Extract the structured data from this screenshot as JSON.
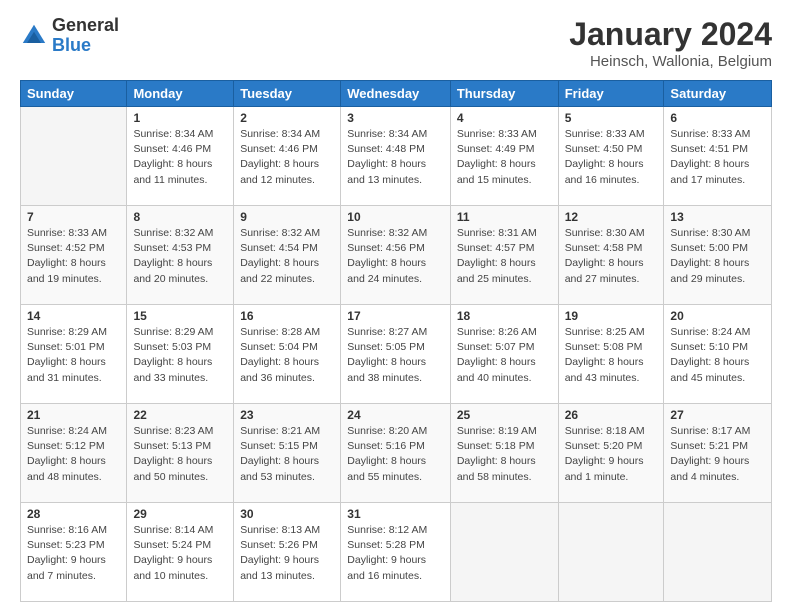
{
  "logo": {
    "general": "General",
    "blue": "Blue"
  },
  "header": {
    "month_year": "January 2024",
    "location": "Heinsch, Wallonia, Belgium"
  },
  "weekdays": [
    "Sunday",
    "Monday",
    "Tuesday",
    "Wednesday",
    "Thursday",
    "Friday",
    "Saturday"
  ],
  "weeks": [
    [
      {
        "day": "",
        "info": ""
      },
      {
        "day": "1",
        "info": "Sunrise: 8:34 AM\nSunset: 4:46 PM\nDaylight: 8 hours\nand 11 minutes."
      },
      {
        "day": "2",
        "info": "Sunrise: 8:34 AM\nSunset: 4:46 PM\nDaylight: 8 hours\nand 12 minutes."
      },
      {
        "day": "3",
        "info": "Sunrise: 8:34 AM\nSunset: 4:48 PM\nDaylight: 8 hours\nand 13 minutes."
      },
      {
        "day": "4",
        "info": "Sunrise: 8:33 AM\nSunset: 4:49 PM\nDaylight: 8 hours\nand 15 minutes."
      },
      {
        "day": "5",
        "info": "Sunrise: 8:33 AM\nSunset: 4:50 PM\nDaylight: 8 hours\nand 16 minutes."
      },
      {
        "day": "6",
        "info": "Sunrise: 8:33 AM\nSunset: 4:51 PM\nDaylight: 8 hours\nand 17 minutes."
      }
    ],
    [
      {
        "day": "7",
        "info": "Sunrise: 8:33 AM\nSunset: 4:52 PM\nDaylight: 8 hours\nand 19 minutes."
      },
      {
        "day": "8",
        "info": "Sunrise: 8:32 AM\nSunset: 4:53 PM\nDaylight: 8 hours\nand 20 minutes."
      },
      {
        "day": "9",
        "info": "Sunrise: 8:32 AM\nSunset: 4:54 PM\nDaylight: 8 hours\nand 22 minutes."
      },
      {
        "day": "10",
        "info": "Sunrise: 8:32 AM\nSunset: 4:56 PM\nDaylight: 8 hours\nand 24 minutes."
      },
      {
        "day": "11",
        "info": "Sunrise: 8:31 AM\nSunset: 4:57 PM\nDaylight: 8 hours\nand 25 minutes."
      },
      {
        "day": "12",
        "info": "Sunrise: 8:30 AM\nSunset: 4:58 PM\nDaylight: 8 hours\nand 27 minutes."
      },
      {
        "day": "13",
        "info": "Sunrise: 8:30 AM\nSunset: 5:00 PM\nDaylight: 8 hours\nand 29 minutes."
      }
    ],
    [
      {
        "day": "14",
        "info": "Sunrise: 8:29 AM\nSunset: 5:01 PM\nDaylight: 8 hours\nand 31 minutes."
      },
      {
        "day": "15",
        "info": "Sunrise: 8:29 AM\nSunset: 5:03 PM\nDaylight: 8 hours\nand 33 minutes."
      },
      {
        "day": "16",
        "info": "Sunrise: 8:28 AM\nSunset: 5:04 PM\nDaylight: 8 hours\nand 36 minutes."
      },
      {
        "day": "17",
        "info": "Sunrise: 8:27 AM\nSunset: 5:05 PM\nDaylight: 8 hours\nand 38 minutes."
      },
      {
        "day": "18",
        "info": "Sunrise: 8:26 AM\nSunset: 5:07 PM\nDaylight: 8 hours\nand 40 minutes."
      },
      {
        "day": "19",
        "info": "Sunrise: 8:25 AM\nSunset: 5:08 PM\nDaylight: 8 hours\nand 43 minutes."
      },
      {
        "day": "20",
        "info": "Sunrise: 8:24 AM\nSunset: 5:10 PM\nDaylight: 8 hours\nand 45 minutes."
      }
    ],
    [
      {
        "day": "21",
        "info": "Sunrise: 8:24 AM\nSunset: 5:12 PM\nDaylight: 8 hours\nand 48 minutes."
      },
      {
        "day": "22",
        "info": "Sunrise: 8:23 AM\nSunset: 5:13 PM\nDaylight: 8 hours\nand 50 minutes."
      },
      {
        "day": "23",
        "info": "Sunrise: 8:21 AM\nSunset: 5:15 PM\nDaylight: 8 hours\nand 53 minutes."
      },
      {
        "day": "24",
        "info": "Sunrise: 8:20 AM\nSunset: 5:16 PM\nDaylight: 8 hours\nand 55 minutes."
      },
      {
        "day": "25",
        "info": "Sunrise: 8:19 AM\nSunset: 5:18 PM\nDaylight: 8 hours\nand 58 minutes."
      },
      {
        "day": "26",
        "info": "Sunrise: 8:18 AM\nSunset: 5:20 PM\nDaylight: 9 hours\nand 1 minute."
      },
      {
        "day": "27",
        "info": "Sunrise: 8:17 AM\nSunset: 5:21 PM\nDaylight: 9 hours\nand 4 minutes."
      }
    ],
    [
      {
        "day": "28",
        "info": "Sunrise: 8:16 AM\nSunset: 5:23 PM\nDaylight: 9 hours\nand 7 minutes."
      },
      {
        "day": "29",
        "info": "Sunrise: 8:14 AM\nSunset: 5:24 PM\nDaylight: 9 hours\nand 10 minutes."
      },
      {
        "day": "30",
        "info": "Sunrise: 8:13 AM\nSunset: 5:26 PM\nDaylight: 9 hours\nand 13 minutes."
      },
      {
        "day": "31",
        "info": "Sunrise: 8:12 AM\nSunset: 5:28 PM\nDaylight: 9 hours\nand 16 minutes."
      },
      {
        "day": "",
        "info": ""
      },
      {
        "day": "",
        "info": ""
      },
      {
        "day": "",
        "info": ""
      }
    ]
  ]
}
